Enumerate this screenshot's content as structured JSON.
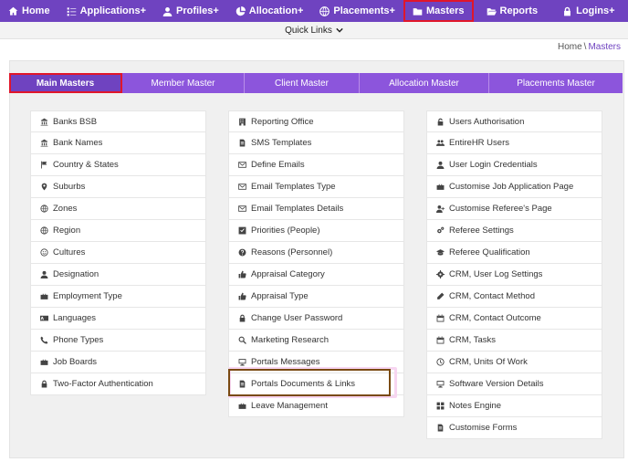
{
  "topnav": {
    "items": [
      {
        "label": "Home",
        "icon": "home-icon"
      },
      {
        "label": "Applications+",
        "icon": "list-icon"
      },
      {
        "label": "Profiles+",
        "icon": "user-icon"
      },
      {
        "label": "Allocation+",
        "icon": "pie-icon"
      },
      {
        "label": "Placements+",
        "icon": "globe-icon"
      },
      {
        "label": "Masters",
        "icon": "folder-icon"
      },
      {
        "label": "Reports",
        "icon": "folder-open-icon"
      },
      {
        "label": "Logins+",
        "icon": "lock-icon"
      }
    ],
    "active": "Masters"
  },
  "quicklinks": {
    "label": "Quick Links"
  },
  "breadcrumb": {
    "home": "Home",
    "sep": "\\",
    "current": "Masters"
  },
  "tabs": [
    {
      "label": "Main Masters"
    },
    {
      "label": "Member Master"
    },
    {
      "label": "Client Master"
    },
    {
      "label": "Allocation Master"
    },
    {
      "label": "Placements Master"
    }
  ],
  "columns": {
    "left": [
      {
        "label": "Banks BSB",
        "icon": "bank-icon"
      },
      {
        "label": "Bank Names",
        "icon": "bank-icon"
      },
      {
        "label": "Country & States",
        "icon": "flag-icon"
      },
      {
        "label": "Suburbs",
        "icon": "map-marker-icon"
      },
      {
        "label": "Zones",
        "icon": "globe-icon"
      },
      {
        "label": "Region",
        "icon": "globe-icon"
      },
      {
        "label": "Cultures",
        "icon": "smile-icon"
      },
      {
        "label": "Designation",
        "icon": "user-icon"
      },
      {
        "label": "Employment Type",
        "icon": "briefcase-icon"
      },
      {
        "label": "Languages",
        "icon": "language-icon"
      },
      {
        "label": "Phone Types",
        "icon": "phone-icon"
      },
      {
        "label": "Job Boards",
        "icon": "briefcase-icon"
      },
      {
        "label": "Two-Factor Authentication",
        "icon": "lock-icon"
      }
    ],
    "middle": [
      {
        "label": "Reporting Office",
        "icon": "building-icon"
      },
      {
        "label": "SMS Templates",
        "icon": "file-icon"
      },
      {
        "label": "Define Emails",
        "icon": "envelope-icon"
      },
      {
        "label": "Email Templates Type",
        "icon": "envelope-icon"
      },
      {
        "label": "Email Templates Details",
        "icon": "envelope-icon"
      },
      {
        "label": "Priorities (People)",
        "icon": "check-square-icon"
      },
      {
        "label": "Reasons (Personnel)",
        "icon": "question-icon"
      },
      {
        "label": "Appraisal Category",
        "icon": "thumbs-up-icon"
      },
      {
        "label": "Appraisal Type",
        "icon": "thumbs-up-icon"
      },
      {
        "label": "Change User Password",
        "icon": "lock-icon"
      },
      {
        "label": "Marketing Research",
        "icon": "search-icon"
      },
      {
        "label": "Portals Messages",
        "icon": "monitor-icon"
      },
      {
        "label": "Portals Documents & Links",
        "icon": "file-icon"
      },
      {
        "label": "Leave Management",
        "icon": "briefcase-icon"
      }
    ],
    "right": [
      {
        "label": "Users Authorisation",
        "icon": "unlock-icon"
      },
      {
        "label": "EntireHR Users",
        "icon": "users-icon"
      },
      {
        "label": "User Login Credentials",
        "icon": "user-icon"
      },
      {
        "label": "Customise Job Application Page",
        "icon": "briefcase-icon"
      },
      {
        "label": "Customise Referee's Page",
        "icon": "user-plus-icon"
      },
      {
        "label": "Referee Settings",
        "icon": "cogs-icon"
      },
      {
        "label": "Referee Qualification",
        "icon": "graduation-cap-icon"
      },
      {
        "label": "CRM, User Log Settings",
        "icon": "gear-icon"
      },
      {
        "label": "CRM, Contact Method",
        "icon": "pencil-icon"
      },
      {
        "label": "CRM, Contact Outcome",
        "icon": "calendar-icon"
      },
      {
        "label": "CRM, Tasks",
        "icon": "calendar-icon"
      },
      {
        "label": "CRM, Units Of Work",
        "icon": "clock-icon"
      },
      {
        "label": "Software Version Details",
        "icon": "monitor-icon"
      },
      {
        "label": "Notes Engine",
        "icon": "grid-icon"
      },
      {
        "label": "Customise Forms",
        "icon": "file-icon"
      }
    ]
  }
}
